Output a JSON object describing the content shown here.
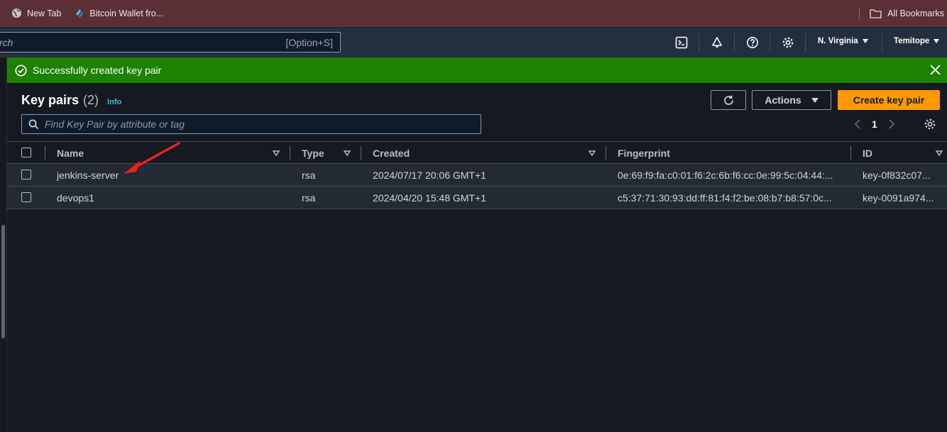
{
  "browser": {
    "bookmarks": [
      {
        "label": "New Tab",
        "icon": "globe-icon"
      },
      {
        "label": "Bitcoin Wallet fro...",
        "icon": "wallet-icon"
      }
    ],
    "all_bookmarks_label": "All Bookmarks"
  },
  "topnav": {
    "search_placeholder": "rch",
    "search_shortcut": "[Option+S]",
    "region": "N. Virginia",
    "user": "Temitope"
  },
  "flash": {
    "message": "Successfully created key pair",
    "color": "#1d8102"
  },
  "panel": {
    "title": "Key pairs",
    "count": "(2)",
    "info_label": "Info",
    "actions_label": "Actions",
    "create_label": "Create key pair",
    "filter_placeholder": "Find Key Pair by attribute or tag",
    "page": "1",
    "accent": "#ff9900"
  },
  "table": {
    "columns": [
      "Name",
      "Type",
      "Created",
      "Fingerprint",
      "ID"
    ],
    "rows": [
      {
        "name": "jenkins-server",
        "type": "rsa",
        "created": "2024/07/17 20:06 GMT+1",
        "fingerprint": "0e:69:f9:fa:c0:01:f6:2c:6b:f6:cc:0e:99:5c:04:44:...",
        "id": "key-0f832c07..."
      },
      {
        "name": "devops1",
        "type": "rsa",
        "created": "2024/04/20 15:48 GMT+1",
        "fingerprint": "c5:37:71:30:93:dd:ff:81:f4:f2:be:08:b7:b8:57:0c...",
        "id": "key-0091a974..."
      }
    ]
  }
}
